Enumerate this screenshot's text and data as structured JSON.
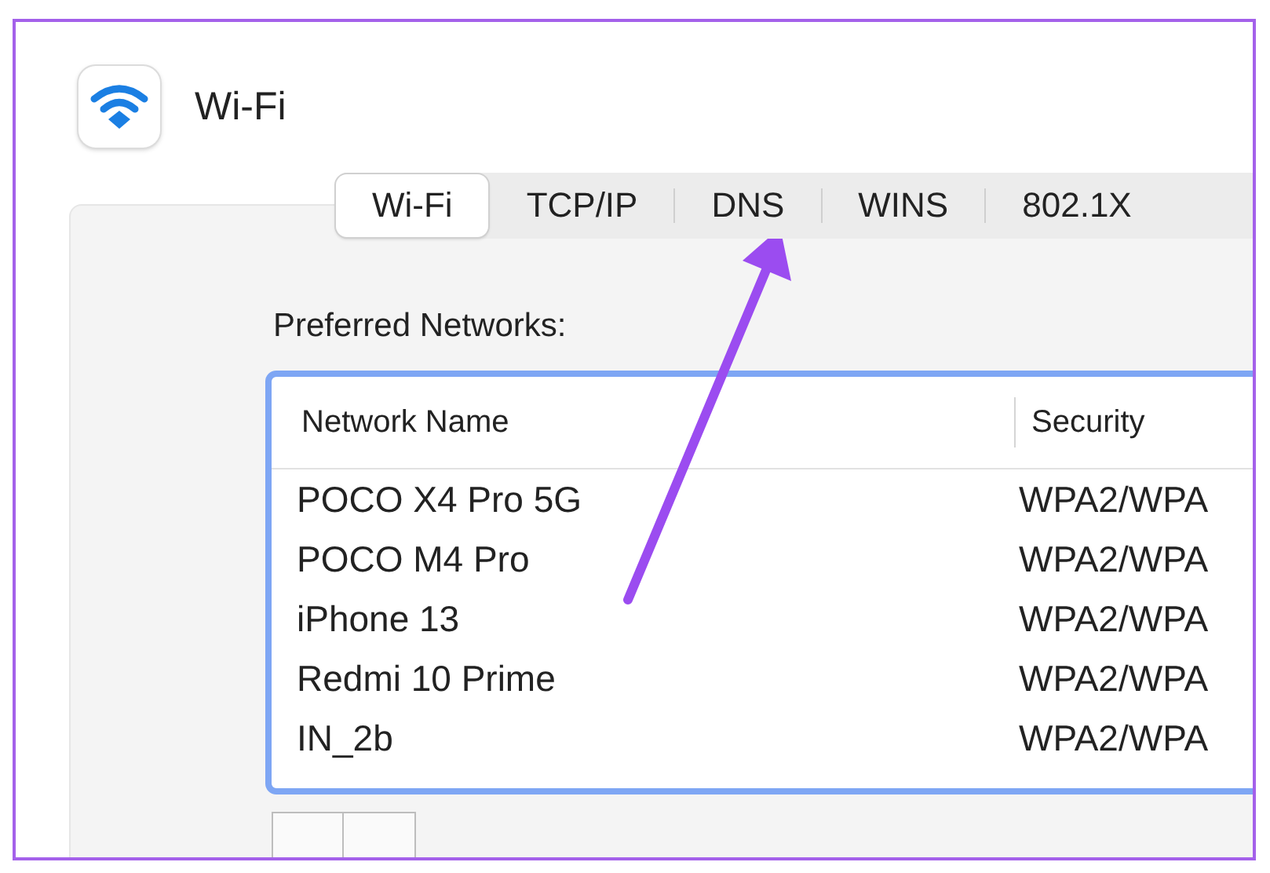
{
  "window": {
    "title": "Wi-Fi"
  },
  "tabs": [
    {
      "label": "Wi-Fi",
      "selected": true
    },
    {
      "label": "TCP/IP",
      "selected": false
    },
    {
      "label": "DNS",
      "selected": false
    },
    {
      "label": "WINS",
      "selected": false
    },
    {
      "label": "802.1X",
      "selected": false
    }
  ],
  "preferred_networks": {
    "label": "Preferred Networks:",
    "columns": [
      "Network Name",
      "Security"
    ],
    "rows": [
      {
        "network_name": "POCO X4 Pro 5G",
        "security": "WPA2/WPA"
      },
      {
        "network_name": "POCO M4 Pro",
        "security": "WPA2/WPA"
      },
      {
        "network_name": "iPhone 13",
        "security": "WPA2/WPA"
      },
      {
        "network_name": "Redmi 10 Prime",
        "security": "WPA2/WPA"
      },
      {
        "network_name": "IN_2b",
        "security": "WPA2/WPA"
      }
    ]
  }
}
